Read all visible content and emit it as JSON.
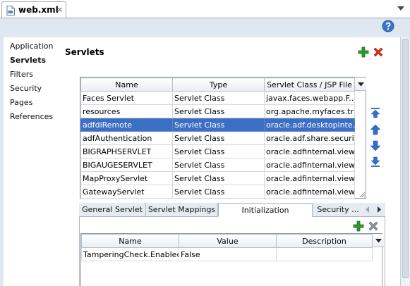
{
  "editor_tab": {
    "title": "web.xml",
    "close_glyph": "×"
  },
  "nav": {
    "items": [
      {
        "label": "Application",
        "active": false
      },
      {
        "label": "Servlets",
        "active": true
      },
      {
        "label": "Filters",
        "active": false
      },
      {
        "label": "Security",
        "active": false
      },
      {
        "label": "Pages",
        "active": false
      },
      {
        "label": "References",
        "active": false
      }
    ]
  },
  "section": {
    "title": "Servlets"
  },
  "servlets_table": {
    "columns": [
      "Name",
      "Type",
      "Servlet Class / JSP File"
    ],
    "rows": [
      [
        "Faces Servlet",
        "Servlet Class",
        "javax.faces.webapp.F..."
      ],
      [
        "resources",
        "Servlet Class",
        "org.apache.myfaces.tri..."
      ],
      [
        "adfdiRemote",
        "Servlet Class",
        "oracle.adf.desktopinte..."
      ],
      [
        "adfAuthentication",
        "Servlet Class",
        "oracle.adf.share.securi..."
      ],
      [
        "BIGRAPHSERVLET",
        "Servlet Class",
        "oracle.adfinternal.view..."
      ],
      [
        "BIGAUGESERVLET",
        "Servlet Class",
        "oracle.adfinternal.view..."
      ],
      [
        "MapProxyServlet",
        "Servlet Class",
        "oracle.adfinternal.view..."
      ],
      [
        "GatewayServlet",
        "Servlet Class",
        "oracle.adfinternal.view..."
      ]
    ],
    "selected_index": 2
  },
  "sub_tabs": {
    "items": [
      "General Servlet",
      "Servlet Mappings",
      "Initialization Parameters",
      "Security ..."
    ],
    "active_index": 2
  },
  "params_table": {
    "columns": [
      "Name",
      "Value",
      "Description"
    ],
    "rows": [
      [
        "TamperingCheck.Enabled",
        "False",
        ""
      ]
    ]
  },
  "colors": {
    "selection": "#3c6fc3",
    "add_green": "#2e9a2e",
    "delete_red": "#d8301c",
    "arrow_blue": "#2f6fc7",
    "panel_background": "#dfe7f0"
  },
  "icons": {
    "tab": "xml-document-icon",
    "help": "help-icon",
    "add": "add-icon",
    "delete": "delete-icon",
    "move_top": "move-to-top-icon",
    "move_up": "move-up-icon",
    "move_down": "move-down-icon",
    "move_bottom": "move-to-bottom-icon"
  }
}
